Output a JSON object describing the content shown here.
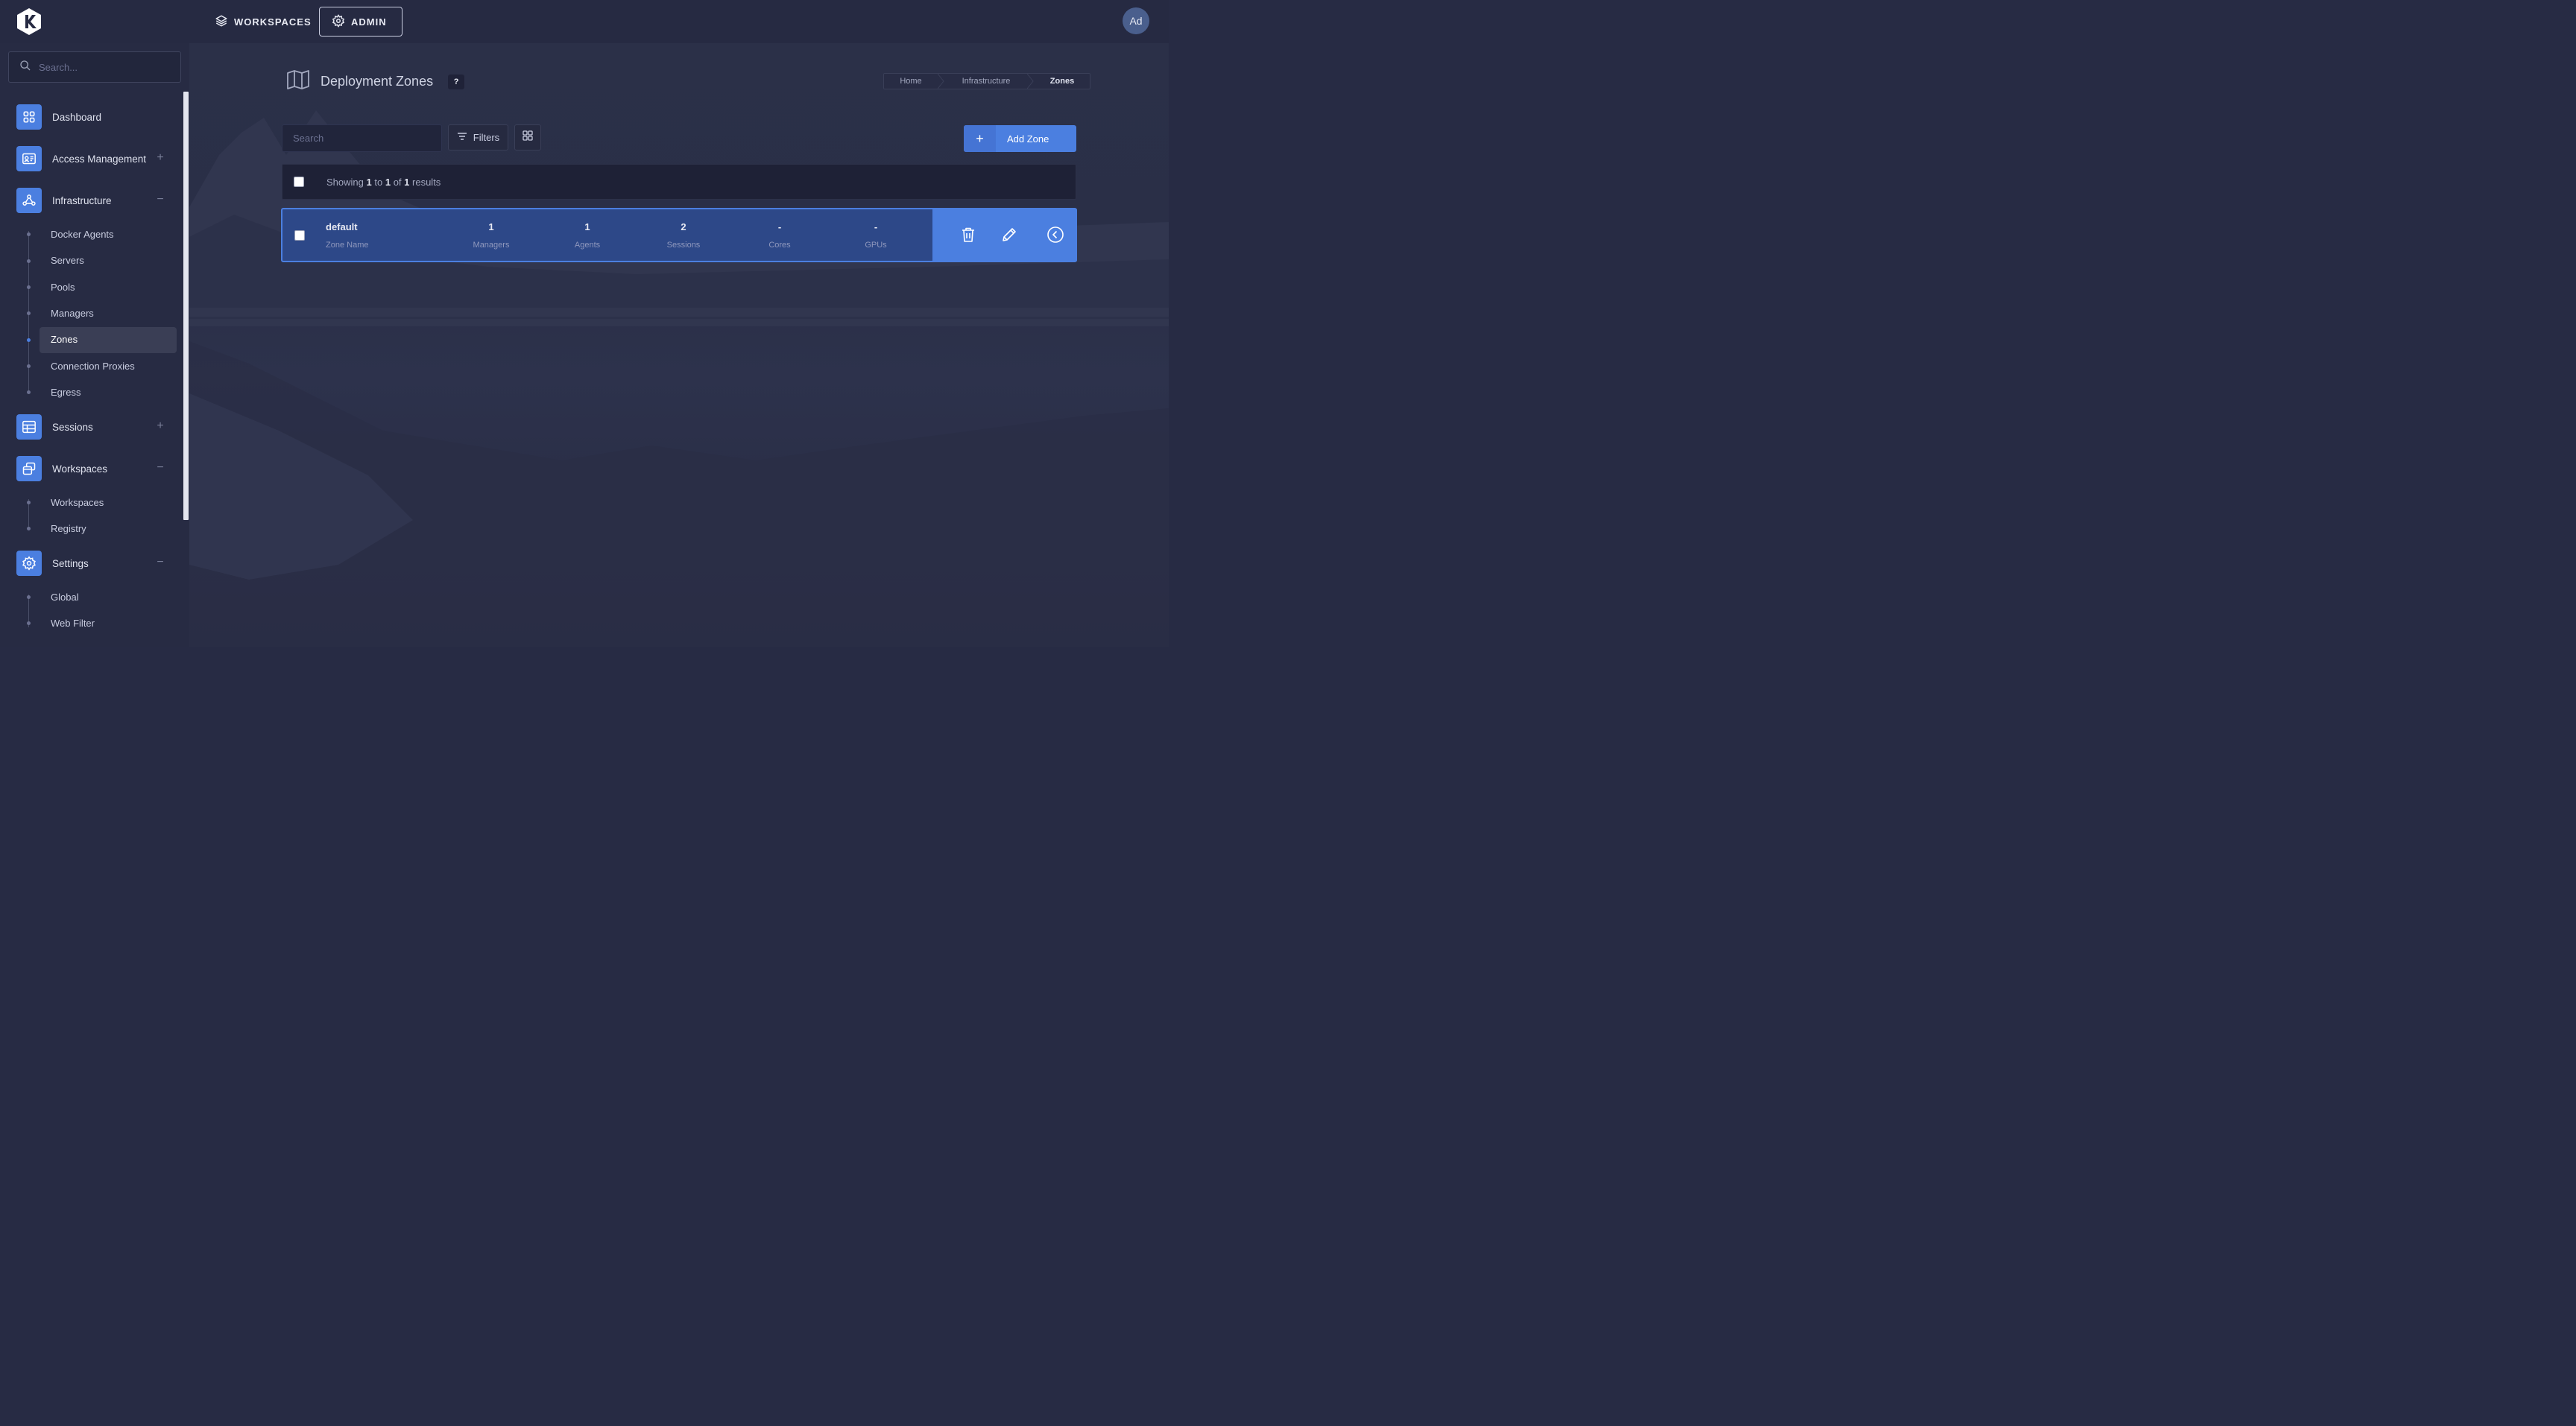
{
  "topbar": {
    "workspaces_label": "WORKSPACES",
    "admin_label": "ADMIN",
    "avatar_initials": "Ad"
  },
  "sidebar": {
    "search_placeholder": "Search...",
    "sections": {
      "dashboard": "Dashboard",
      "access_management": "Access Management",
      "infrastructure": "Infrastructure",
      "sessions": "Sessions",
      "workspaces": "Workspaces",
      "settings": "Settings"
    },
    "infrastructure_items": [
      "Docker Agents",
      "Servers",
      "Pools",
      "Managers",
      "Zones",
      "Connection Proxies",
      "Egress"
    ],
    "workspaces_items": [
      "Workspaces",
      "Registry"
    ],
    "settings_items": [
      "Global",
      "Web Filter"
    ],
    "active_item": "Zones"
  },
  "page": {
    "title": "Deployment Zones",
    "help": "?",
    "breadcrumb": [
      "Home",
      "Infrastructure",
      "Zones"
    ]
  },
  "toolbar": {
    "search_placeholder": "Search",
    "filters_label": "Filters",
    "add_label": "Add Zone",
    "add_plus": "+"
  },
  "results": {
    "prefix": "Showing",
    "from": "1",
    "to_word": "to",
    "to": "1",
    "of_word": "of",
    "total": "1",
    "suffix": "results"
  },
  "zones": [
    {
      "name": "default",
      "name_label": "Zone Name",
      "managers": "1",
      "managers_label": "Managers",
      "agents": "1",
      "agents_label": "Agents",
      "sessions": "2",
      "sessions_label": "Sessions",
      "cores": "-",
      "cores_label": "Cores",
      "gpus": "-",
      "gpus_label": "GPUs"
    }
  ],
  "colors": {
    "accent": "#4b7fe0",
    "background": "#272b44",
    "selected_row": "#2d4888"
  },
  "icons": [
    "logo-icon",
    "layers-icon",
    "gear-icon",
    "search-icon",
    "dashboard-icon",
    "id-card-icon",
    "network-icon",
    "table-icon",
    "windows-icon",
    "settings-gear-icon",
    "map-icon",
    "filter-icon",
    "grid-icon",
    "trash-icon",
    "pencil-icon",
    "chevron-left-circle-icon"
  ]
}
